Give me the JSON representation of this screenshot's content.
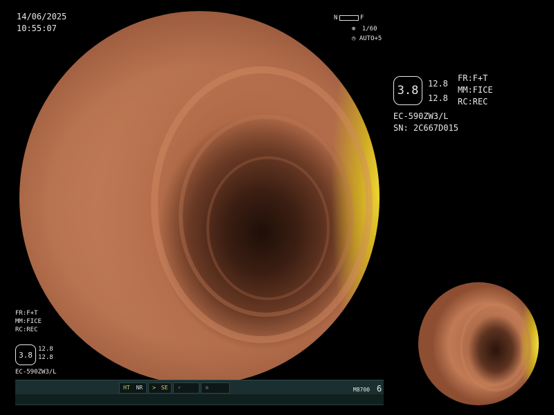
{
  "header": {
    "date": "14/06/2025",
    "time": "10:55:07"
  },
  "top_right": {
    "nf_left": "N",
    "nf_right": "F",
    "shutter": "1/60",
    "auto_gain": "AUTO+5"
  },
  "info_panel": {
    "hex_value": "3.8",
    "value_top": "12.8",
    "value_bottom": "12.8",
    "fr": "FR:F+T",
    "mm": "MM:FICE",
    "rc": "RC:REC",
    "model": "EC-590ZW3/L",
    "serial": "SN: 2C667D015"
  },
  "left_panel": {
    "fr": "FR:F+T",
    "mm": "MM:FICE",
    "rc": "RC:REC",
    "hex_value": "3.8",
    "value_top": "12.8",
    "value_bottom": "12.8",
    "model": "EC-590ZW3/L"
  },
  "status_bar": {
    "ht": "HT",
    "nr": "NR",
    "se": "SE",
    "device": "M8700",
    "counter": "6"
  },
  "icons": [
    "clock-icon",
    "gain-icon",
    "shutter-icon",
    "se-icon",
    "flash-icon",
    "circle-icon"
  ]
}
